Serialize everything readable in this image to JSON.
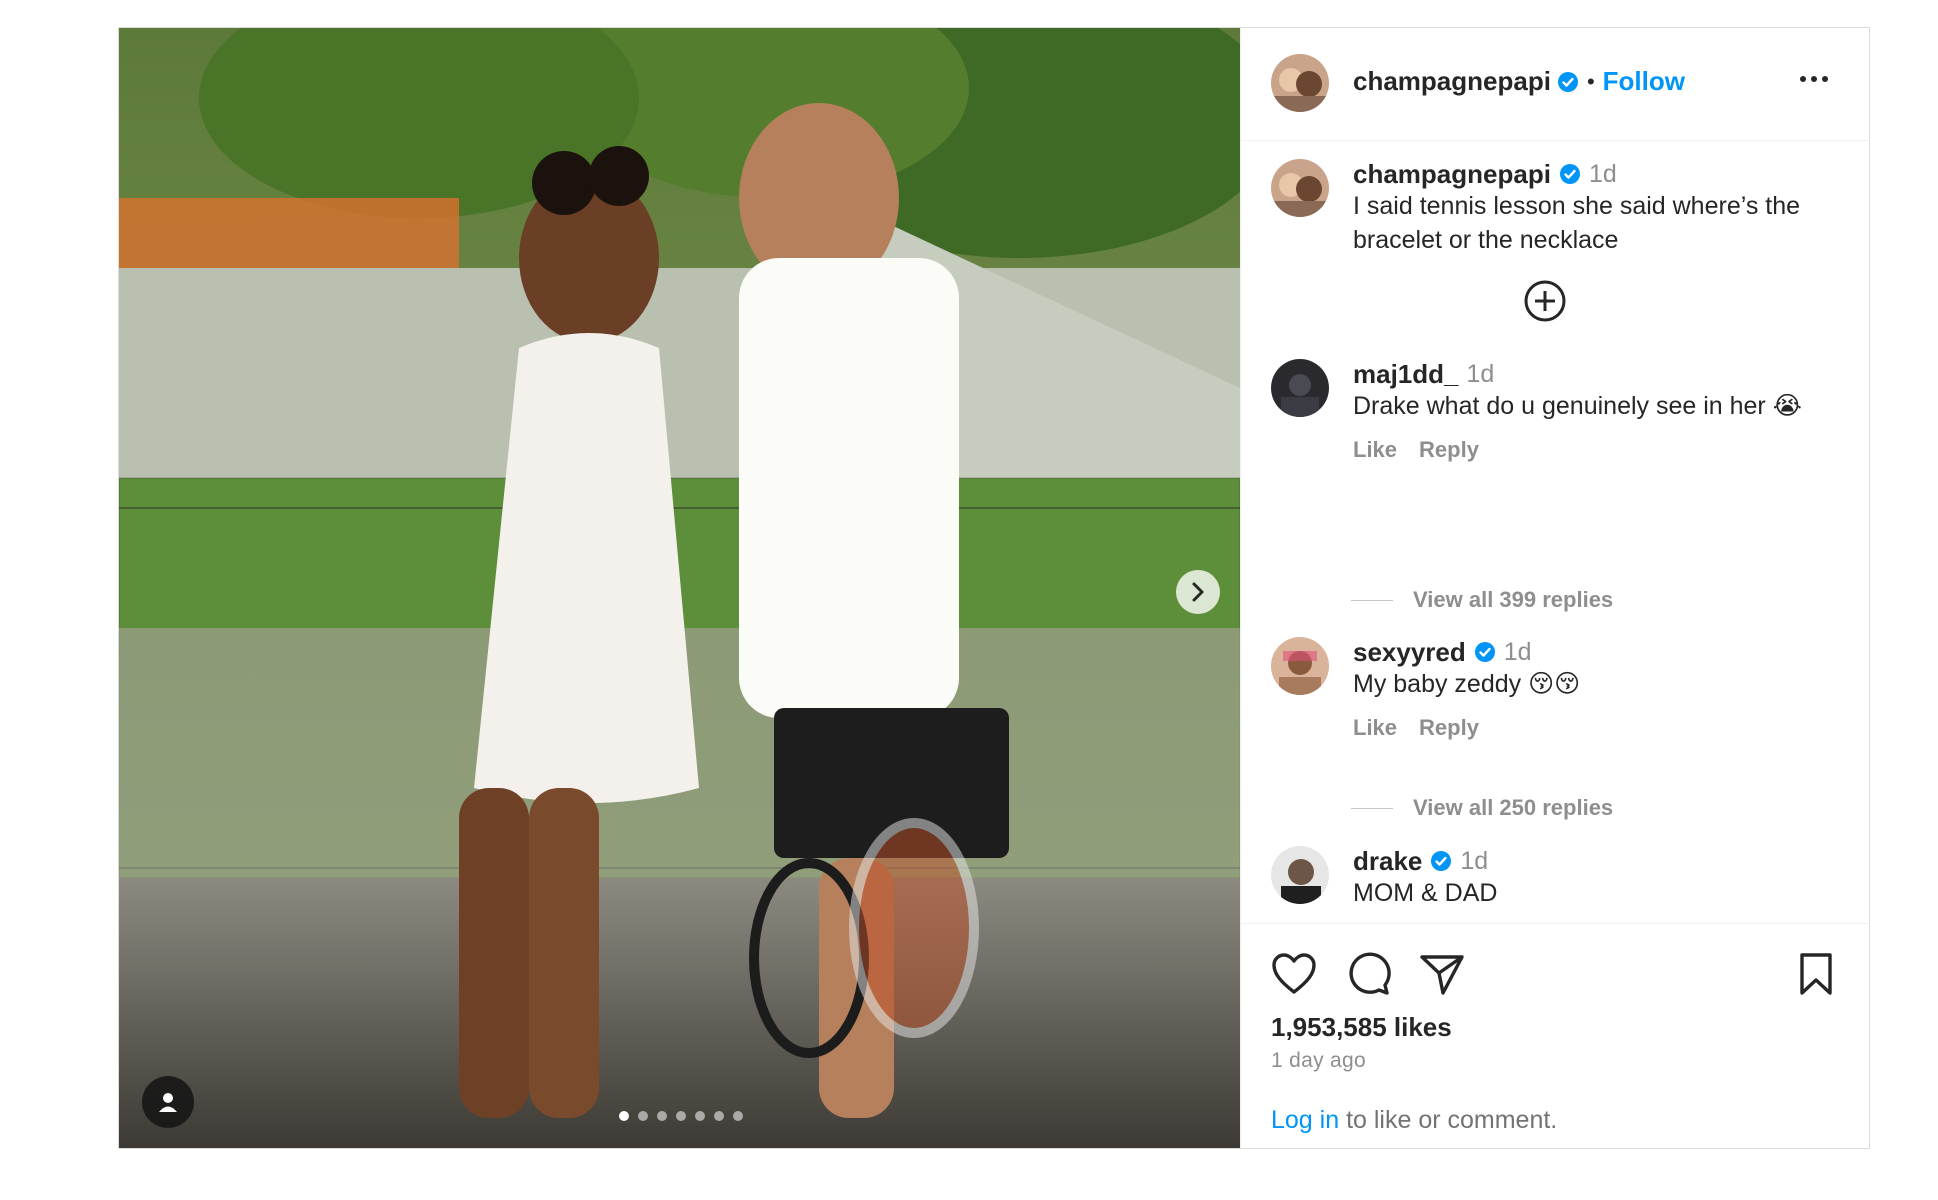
{
  "post": {
    "author": "champagnepapi",
    "follow_label": "Follow",
    "separator": "•",
    "carousel": {
      "slide_count": 7,
      "active_index": 0
    }
  },
  "caption": {
    "username": "champagnepapi",
    "time": "1d",
    "text": "I said tennis lesson she said where’s the bracelet or the necklace"
  },
  "comments": [
    {
      "username": "maj1dd_",
      "verified": false,
      "time": "1d",
      "text": "Drake what do u genuinely see in her 😭",
      "like_label": "Like",
      "reply_label": "Reply",
      "view_replies": "View all 399 replies"
    },
    {
      "username": "sexyyred",
      "verified": true,
      "time": "1d",
      "text": "My baby zeddy 😚😚",
      "like_label": "Like",
      "reply_label": "Reply",
      "view_replies": "View all 250 replies"
    },
    {
      "username": "drake",
      "verified": true,
      "time": "1d",
      "text": "MOM & DAD"
    }
  ],
  "footer": {
    "likes": "1,953,585 likes",
    "time_ago": "1 day ago",
    "login_link": "Log in",
    "login_suffix": " to like or comment."
  },
  "colors": {
    "accent": "#0095f6",
    "verified": "#0095f6",
    "muted": "#8e8e8e",
    "text": "#262626"
  },
  "icons": [
    "more-options-icon",
    "verified-badge-icon",
    "add-circle-icon",
    "heart-icon",
    "comment-icon",
    "share-icon",
    "bookmark-icon",
    "chevron-right-icon",
    "user-tag-icon"
  ]
}
